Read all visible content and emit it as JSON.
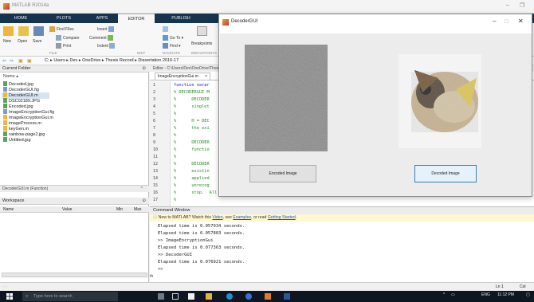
{
  "window": {
    "title": "MATLAB R2014a"
  },
  "ribbon": {
    "tabs": [
      "HOME",
      "PLOTS",
      "APPS",
      "EDITOR",
      "PUBLISH",
      "VIEW"
    ],
    "buttons": {
      "new": "New",
      "open": "Open",
      "save": "Save",
      "find_files": "Find Files",
      "compare": "Compare",
      "print": "Print",
      "insert": "Insert",
      "comment": "Comment",
      "indent": "Indent",
      "go_to": "Go To",
      "find": "Find",
      "breakpoints": "Breakpoints"
    },
    "groups": [
      "FILE",
      "EDIT",
      "NAVIGATE",
      "BREAKPOINTS"
    ]
  },
  "address": {
    "crumbs": [
      "C:",
      "Users",
      "Dev",
      "OneDrive",
      "Thesis Record",
      "Dissertation 2016-17"
    ]
  },
  "current_folder": {
    "title": "Current Folder",
    "column": "Name",
    "files": [
      {
        "name": "Decoded.jpg",
        "kind": "img"
      },
      {
        "name": "DecoderGUI.fig",
        "kind": "fig"
      },
      {
        "name": "DecoderGUI.m",
        "kind": "m"
      },
      {
        "name": "DSC02189.JPG",
        "kind": "img"
      },
      {
        "name": "Encoded.jpg",
        "kind": "img"
      },
      {
        "name": "ImageEncryptionGui.fig",
        "kind": "fig"
      },
      {
        "name": "ImageEncryptionGui.m",
        "kind": "m"
      },
      {
        "name": "imageProcess.m",
        "kind": "m"
      },
      {
        "name": "keyGen.m",
        "kind": "m"
      },
      {
        "name": "rainbow-page2.jpg",
        "kind": "img"
      },
      {
        "name": "Untitled.jpg",
        "kind": "img"
      }
    ],
    "details": "DecoderGUI.m (Function)"
  },
  "workspace": {
    "title": "Workspace",
    "columns": [
      "Name",
      "Value",
      "Min",
      "Max"
    ]
  },
  "editor": {
    "header": "Editor - C:\\Users\\Dev\\OneDrive\\Thesis Record\\Dissertation 2016-17\\ImageEncryptionGui.m",
    "tab": "ImageEncryptionGui.m",
    "lines": [
      {
        "n": "1",
        "text": "function varar",
        "kw": true
      },
      {
        "n": "2",
        "text": "% DECODERGUI M",
        "kw": false
      },
      {
        "n": "3",
        "text": "%      DECODER",
        "kw": false
      },
      {
        "n": "4",
        "text": "%      singlet",
        "kw": false
      },
      {
        "n": "5",
        "text": "%",
        "kw": false
      },
      {
        "n": "6",
        "text": "%      H = DEC",
        "kw": false
      },
      {
        "n": "7",
        "text": "%      the exi",
        "kw": false
      },
      {
        "n": "8",
        "text": "%",
        "kw": false
      },
      {
        "n": "9",
        "text": "%      DECODER",
        "kw": false
      },
      {
        "n": "10",
        "text": "%      functio",
        "kw": false
      },
      {
        "n": "11",
        "text": "%",
        "kw": false
      },
      {
        "n": "12",
        "text": "%      DECODER",
        "kw": false
      },
      {
        "n": "13",
        "text": "%      existin",
        "kw": false
      },
      {
        "n": "14",
        "text": "%      applied",
        "kw": false
      },
      {
        "n": "15",
        "text": "%      unrecog",
        "kw": false
      },
      {
        "n": "16",
        "text": "%      stop.  All inputs are passed to DecoderGUI_OpeningFcn via varargin.",
        "kw": false
      },
      {
        "n": "17",
        "text": "%",
        "kw": false
      }
    ]
  },
  "command_window": {
    "title": "Command Window",
    "notice_prefix": "New to MATLAB? Watch this ",
    "notice_video": "Video",
    "notice_mid": ", see ",
    "notice_examples": "Examples",
    "notice_mid2": ", or read ",
    "notice_getting_started": "Getting Started",
    "notice_suffix": ".",
    "lines": [
      "Elapsed time is 0.057934 seconds.",
      "Elapsed time is 0.057803 seconds.",
      ">> ImageEncryptionGui",
      "Elapsed time is 0.077363 seconds.",
      ">> DecoderGUI",
      "Elapsed time is 0.076921 seconds.",
      ">>"
    ],
    "prompt_symbol": "fx"
  },
  "status": {
    "position": "Ln 1",
    "col": "Col"
  },
  "gui": {
    "title": "DecoderGUI",
    "encoded_button": "Encoded Image",
    "decoded_button": "Decoded Image"
  },
  "taskbar": {
    "search_placeholder": "Type here to search",
    "lang": "ENG",
    "time": "11:12 PM"
  },
  "colors": {
    "ribbon_tabs": "#17344f",
    "comment_green": "#228b22",
    "keyword_blue": "#1515d6",
    "link_blue": "#1b55c4",
    "taskbar": "#0e1621"
  }
}
